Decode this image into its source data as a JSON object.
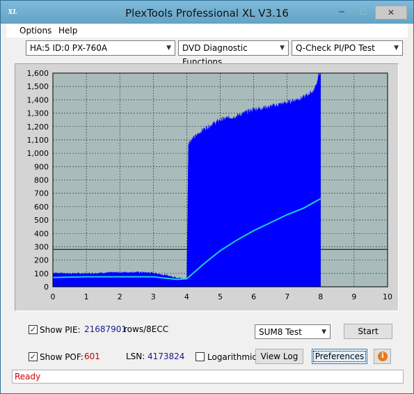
{
  "window": {
    "title": "PlexTools Professional XL V3.16",
    "icon_label": "XL"
  },
  "menu": [
    "Options",
    "Help"
  ],
  "toolbar": {
    "drive": "HA:5 ID:0  PX-760A",
    "function": "DVD Diagnostic Functions",
    "test": "Q-Check PI/PO Test"
  },
  "controls": {
    "show_pie_label": "Show PIE:",
    "pie_value": "21687901",
    "pie_unit": "rows/8ECC",
    "show_poe_label": "Show POF:",
    "poe_value": "601",
    "lsn_label": "LSN:",
    "lsn_value": "4173824",
    "logarithmic_label": "Logarithmic",
    "sum_select": "SUM8 Test",
    "start_label": "Start",
    "view_log_label": "View Log",
    "preferences_label": "Preferences"
  },
  "status": {
    "text": "Ready"
  },
  "colors": {
    "bars": "#0000ff",
    "curve": "#1ecfe0",
    "plot_bg": "#a9bcbb",
    "threshold": "#000000",
    "status": "#d00000"
  },
  "chart_data": {
    "type": "area",
    "xlim": [
      0,
      10
    ],
    "ylim": [
      0,
      1600
    ],
    "x_ticks": [
      "0",
      "1",
      "2",
      "3",
      "4",
      "5",
      "6",
      "7",
      "8",
      "9",
      "10"
    ],
    "y_ticks": [
      "0",
      "100",
      "200",
      "300",
      "400",
      "500",
      "600",
      "700",
      "800",
      "900",
      "1,000",
      "1,100",
      "1,200",
      "1,300",
      "1,400",
      "1,500",
      "1,600"
    ],
    "threshold": 280,
    "grid": true,
    "series": [
      {
        "type": "bar",
        "x": [
          0,
          0.5,
          1,
          1.5,
          2,
          2.5,
          3,
          3.5,
          3.9,
          4.0,
          4.05,
          4.5,
          5,
          5.5,
          6,
          6.5,
          7,
          7.5,
          7.8,
          7.9,
          7.95,
          8.0
        ],
        "y": [
          105,
          100,
          100,
          105,
          108,
          110,
          105,
          80,
          60,
          60,
          1080,
          1180,
          1250,
          1280,
          1330,
          1350,
          1380,
          1420,
          1470,
          1540,
          1600,
          1600
        ]
      },
      {
        "type": "line",
        "x": [
          0,
          1,
          2,
          3,
          3.7,
          4.0,
          4.5,
          5,
          5.5,
          6,
          6.5,
          7,
          7.5,
          8.0
        ],
        "y": [
          70,
          75,
          75,
          75,
          55,
          60,
          170,
          270,
          350,
          420,
          480,
          540,
          590,
          660
        ]
      }
    ]
  }
}
